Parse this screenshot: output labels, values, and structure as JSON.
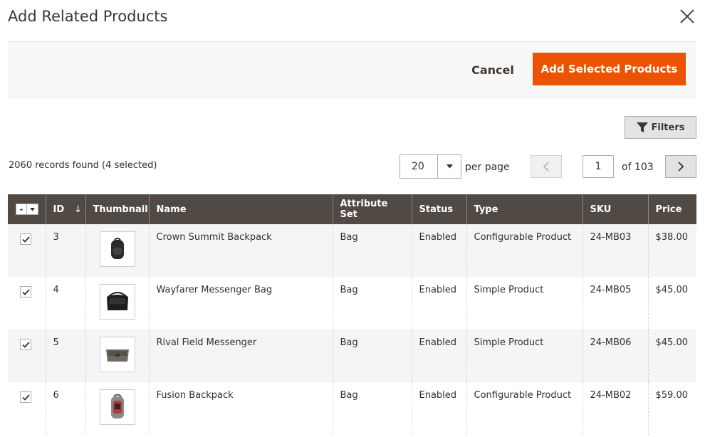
{
  "modal": {
    "title": "Add Related Products",
    "close_icon": "close-icon"
  },
  "toolbar": {
    "cancel_label": "Cancel",
    "add_selected_label": "Add Selected Products",
    "primary_color": "#eb5202"
  },
  "filters": {
    "label": "Filters",
    "icon": "filter-icon"
  },
  "grid_info": {
    "records_text": "2060 records found (4 selected)",
    "per_page_value": "20",
    "per_page_label": "per page",
    "current_page": "1",
    "of_pages": "of 103"
  },
  "table": {
    "header_color": "#514943",
    "columns": {
      "id": "ID",
      "id_sort": "↓",
      "thumbnail": "Thumbnail",
      "name": "Name",
      "attribute_set": "Attribute Set",
      "status": "Status",
      "type": "Type",
      "sku": "SKU",
      "price": "Price"
    },
    "mass_select_label": "-",
    "rows": [
      {
        "checked": true,
        "id": "3",
        "thumbnail": "backpack-image",
        "name": "Crown Summit Backpack",
        "attribute_set": "Bag",
        "status": "Enabled",
        "type": "Configurable Product",
        "sku": "24-MB03",
        "price": "$38.00"
      },
      {
        "checked": true,
        "id": "4",
        "thumbnail": "messenger-bag-image",
        "name": "Wayfarer Messenger Bag",
        "attribute_set": "Bag",
        "status": "Enabled",
        "type": "Simple Product",
        "sku": "24-MB05",
        "price": "$45.00"
      },
      {
        "checked": true,
        "id": "5",
        "thumbnail": "messenger-bag-image",
        "name": "Rival Field Messenger",
        "attribute_set": "Bag",
        "status": "Enabled",
        "type": "Simple Product",
        "sku": "24-MB06",
        "price": "$45.00"
      },
      {
        "checked": true,
        "id": "6",
        "thumbnail": "backpack-image",
        "name": "Fusion Backpack",
        "attribute_set": "Bag",
        "status": "Enabled",
        "type": "Configurable Product",
        "sku": "24-MB02",
        "price": "$59.00"
      }
    ]
  }
}
